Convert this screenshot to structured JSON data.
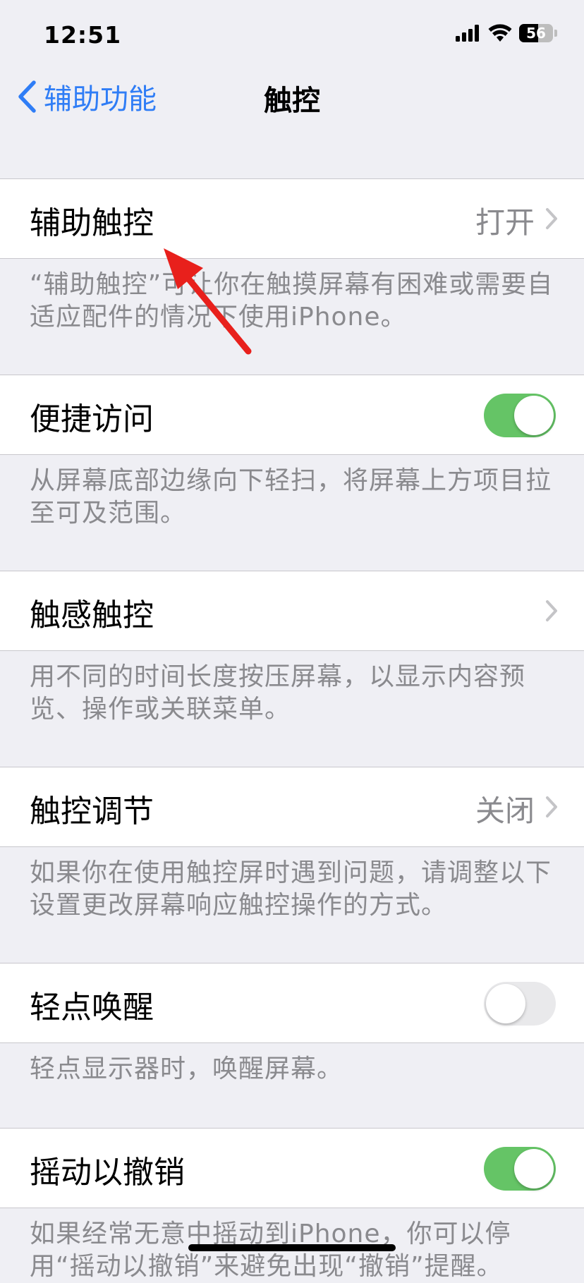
{
  "status_bar": {
    "time": "12:51",
    "battery": "56",
    "battery_level": 0.56
  },
  "nav": {
    "back_label": "辅助功能",
    "title": "触控"
  },
  "settings": [
    {
      "label": "辅助触控",
      "value": "打开",
      "chevron": true,
      "footer": "“辅助触控”可让你在触摸屏幕有困难或需要自适应配件的情况下使用iPhone。"
    },
    {
      "label": "便捷访问",
      "toggle": "on",
      "footer": "从屏幕底部边缘向下轻扫，将屏幕上方项目拉至可及范围。"
    },
    {
      "label": "触感触控",
      "chevron": true,
      "footer": "用不同的时间长度按压屏幕，以显示内容预览、操作或关联菜单。"
    },
    {
      "label": "触控调节",
      "value": "关闭",
      "chevron": true,
      "footer": "如果你在使用触控屏时遇到问题，请调整以下设置更改屏幕响应触控操作的方式。"
    },
    {
      "label": "轻点唤醒",
      "toggle": "off",
      "footer": "轻点显示器时，唤醒屏幕。"
    },
    {
      "label": "摇动以撤销",
      "toggle": "on",
      "footer": "如果经常无意中摇动到iPhone，你可以停用“摇动以撤销”来避免出现“撤销”提醒。"
    }
  ],
  "colors": {
    "accent": "#2f7df6",
    "toggle_on": "#65c466",
    "annotation_arrow": "#e8201c"
  }
}
